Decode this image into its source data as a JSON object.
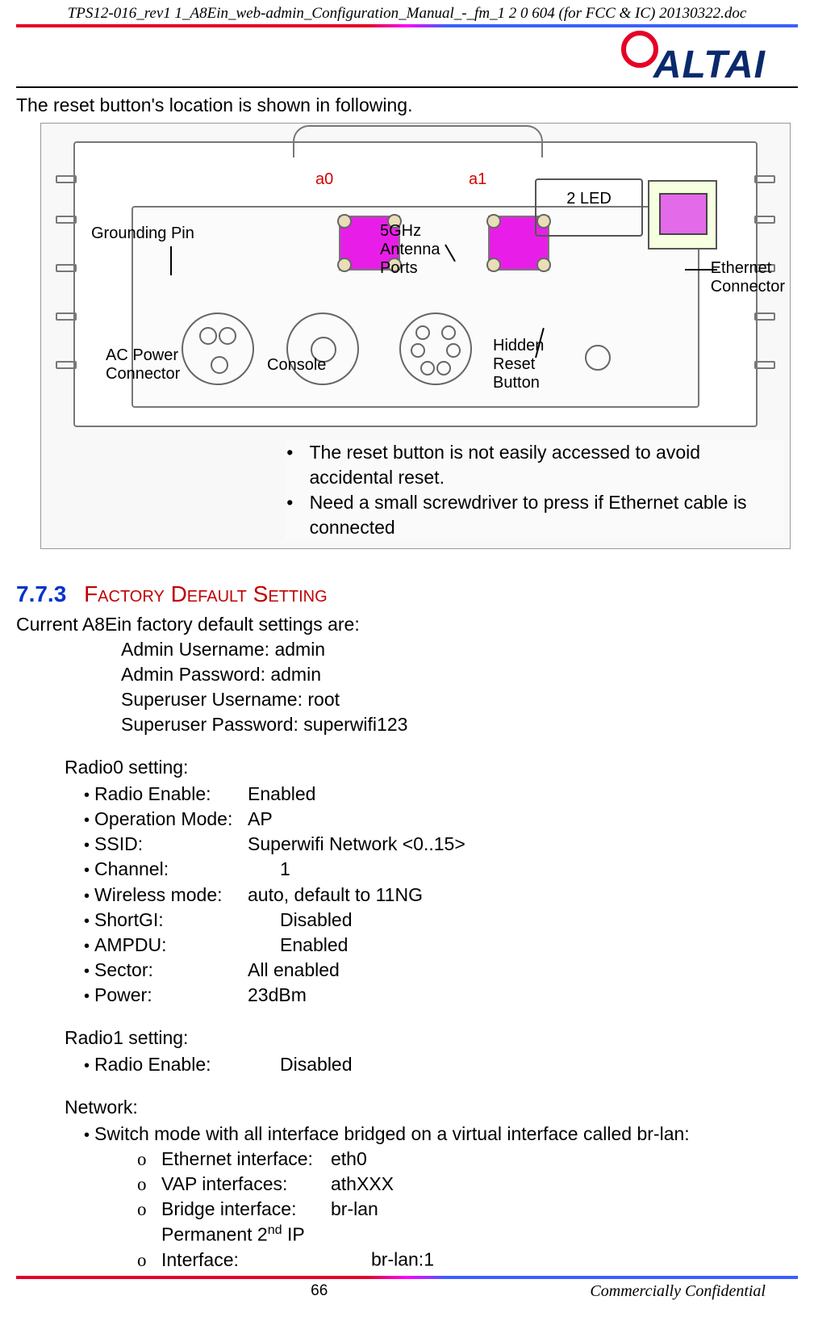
{
  "header": {
    "filename": "TPS12-016_rev1 1_A8Ein_web-admin_Configuration_Manual_-_fm_1 2 0 604 (for FCC & IC) 20130322.doc",
    "logo_text": "ALTAI"
  },
  "intro": "The reset button's location is shown in following.",
  "figure": {
    "labels": {
      "grounding": "Grounding Pin",
      "a0": "a0",
      "a1": "a1",
      "antenna": "5GHz\nAntenna\nPorts",
      "led": "2 LED",
      "ethernet": "Ethernet\nConnector",
      "ac_power": "AC Power\nConnector",
      "console": "Console",
      "reset": "Hidden\nReset\nButton"
    },
    "notes": [
      "The reset button is not easily accessed to avoid accidental reset.",
      "Need a small screwdriver to press if Ethernet cable is connected"
    ]
  },
  "section": {
    "number": "7.7.3",
    "title": "Factory Default Setting",
    "intro": "Current A8Ein factory default settings are:",
    "credentials": [
      "Admin Username: admin",
      "Admin Password: admin",
      "Superuser Username: root",
      "Superuser Password: superwifi123"
    ],
    "radio0": {
      "heading": "Radio0 setting:",
      "items": [
        {
          "label": "Radio Enable:",
          "value": "Enabled"
        },
        {
          "label": "Operation Mode:",
          "value": "AP"
        },
        {
          "label": "SSID:",
          "value": "Superwifi Network <0..15>"
        },
        {
          "label": "Channel:",
          "value": "1"
        },
        {
          "label": "Wireless mode:",
          "value": "auto, default to 11NG"
        },
        {
          "label": "ShortGI:",
          "value": "Disabled"
        },
        {
          "label": "AMPDU:",
          "value": "Enabled"
        },
        {
          "label": "Sector:",
          "value": "All enabled"
        },
        {
          "label": "Power:",
          "value": "23dBm"
        }
      ]
    },
    "radio1": {
      "heading": "Radio1 setting:",
      "items": [
        {
          "label": "Radio Enable:",
          "value": "Disabled"
        }
      ]
    },
    "network": {
      "heading": "Network:",
      "bridge_intro": "Switch mode with all interface bridged on a virtual interface called br-lan:",
      "items": [
        {
          "label": "Ethernet interface:",
          "value": "eth0"
        },
        {
          "label": "VAP interfaces:",
          "value": "athXXX"
        },
        {
          "label": "Bridge interface:",
          "value": "br-lan"
        },
        {
          "label_html": "Permanent 2<sup>nd</sup> IP Interface:",
          "value": "br-lan:1"
        }
      ]
    }
  },
  "footer": {
    "page_number": "66",
    "confidential": "Commercially Confidential"
  }
}
